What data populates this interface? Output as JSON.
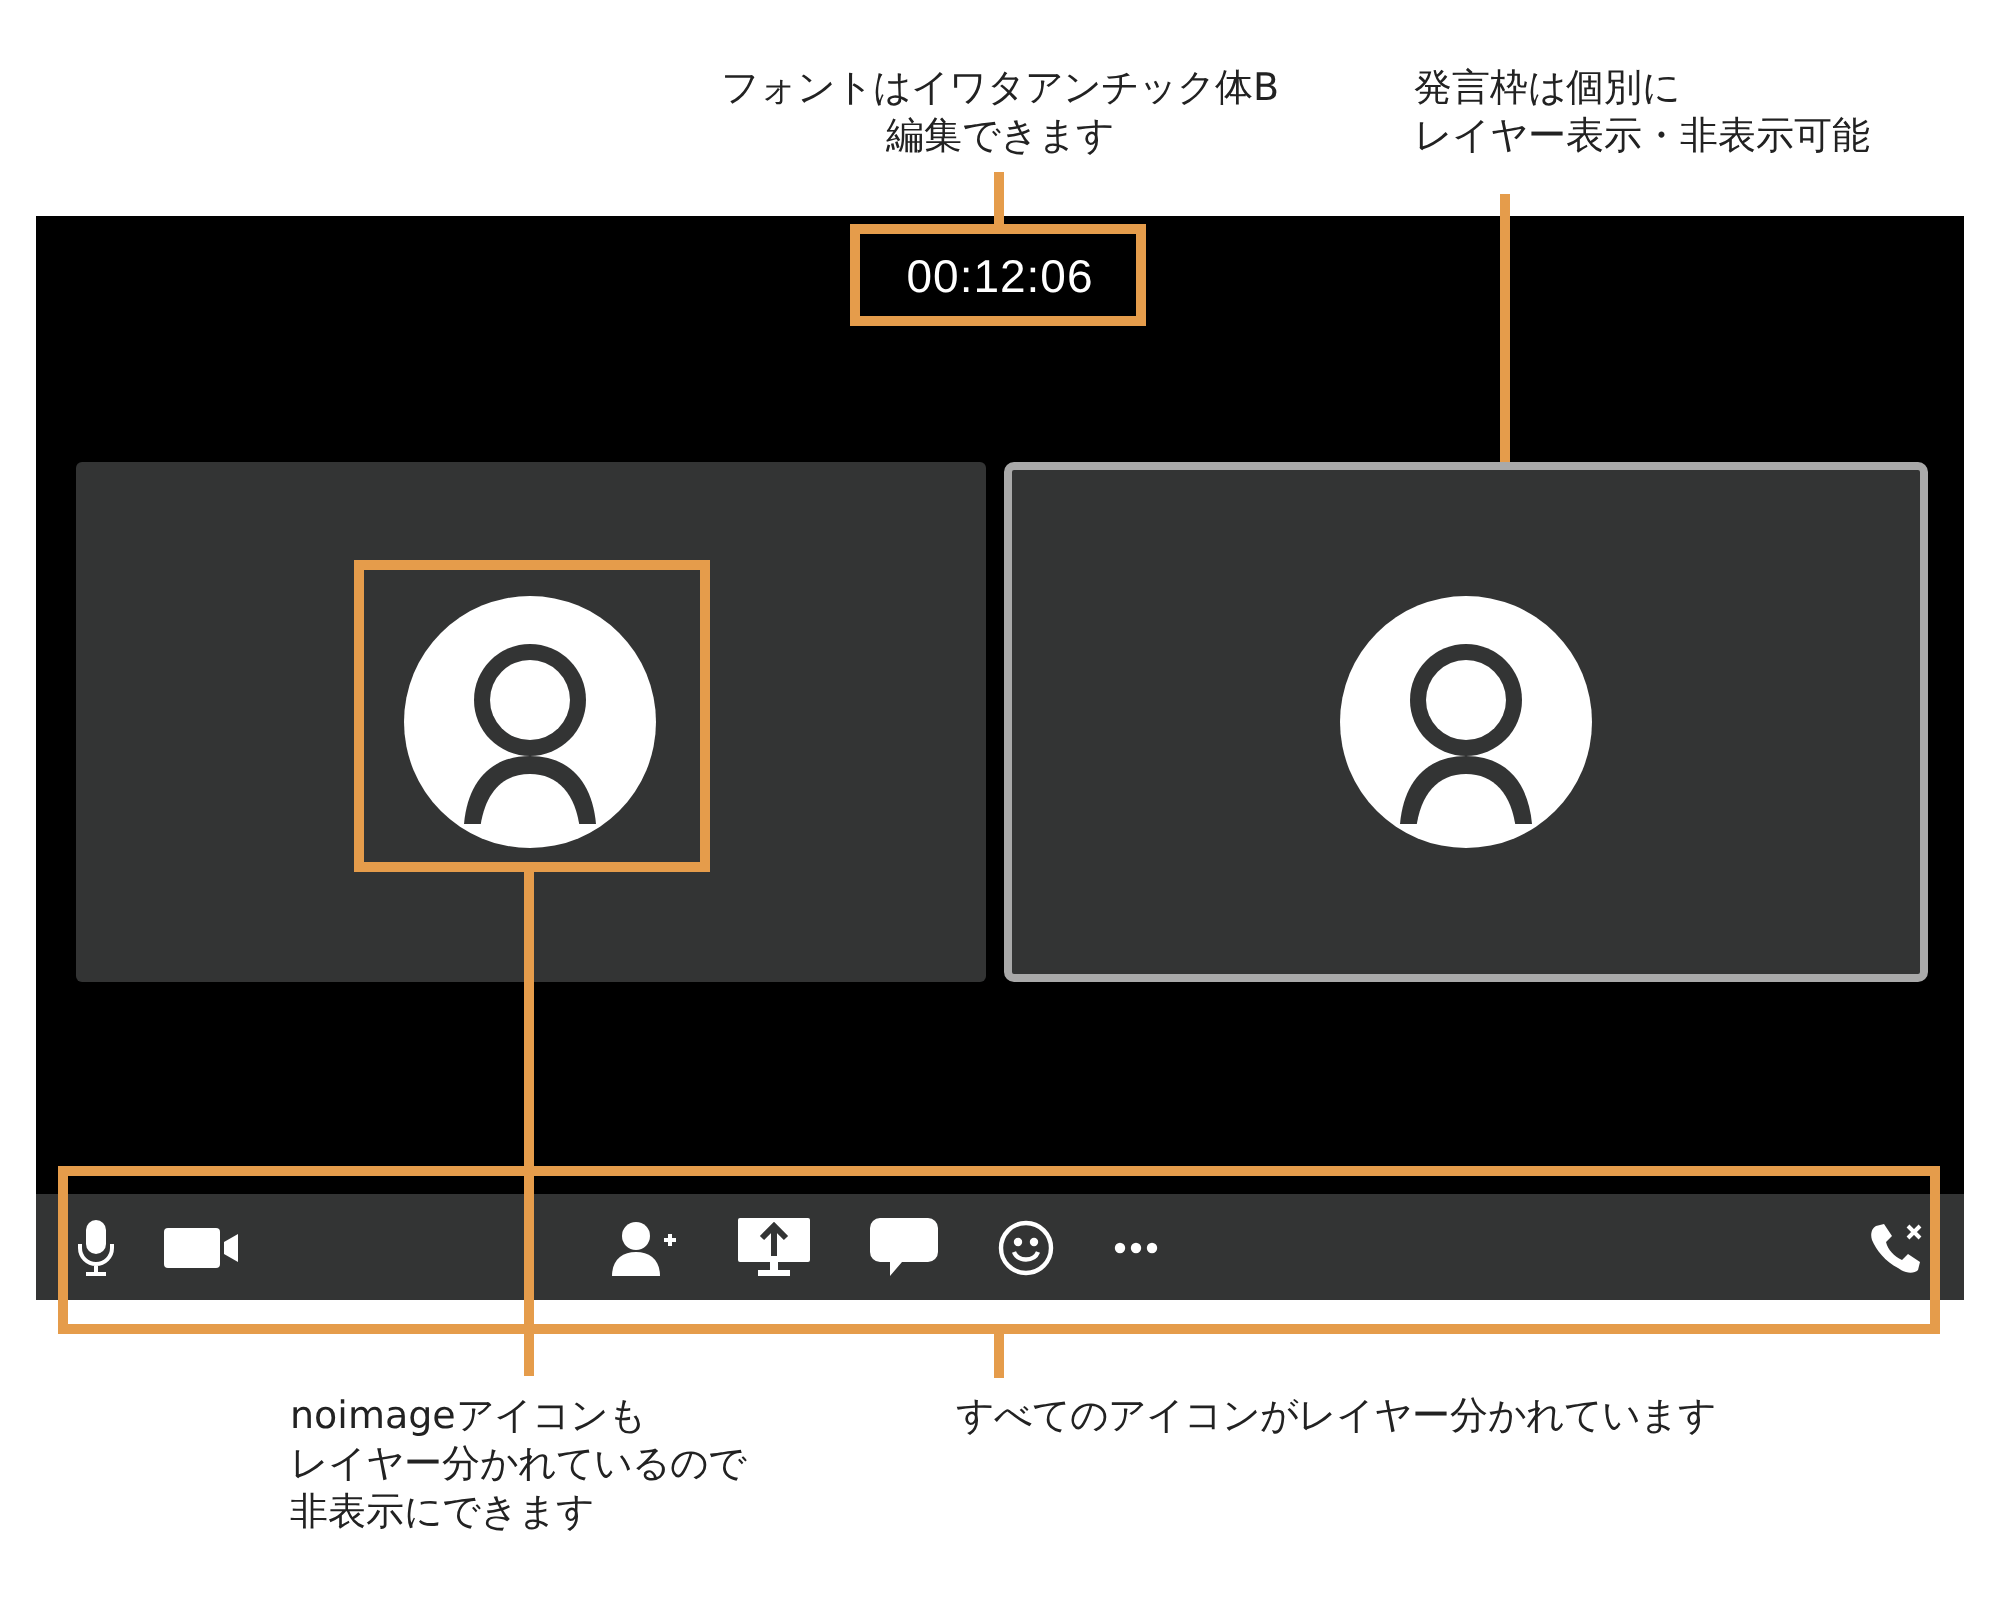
{
  "call": {
    "timer": "00:12:06",
    "tiles": [
      {
        "speaking": false
      },
      {
        "speaking": true
      }
    ]
  },
  "annotations": [
    {
      "lines": [
        "フォントはイワタアンチック体B",
        "編集できます"
      ]
    },
    {
      "lines": [
        "発言枠は個別に",
        "レイヤー表示・非表示可能"
      ]
    },
    {
      "lines": [
        "noimageアイコンも",
        "レイヤー分かれているので",
        "非表示にできます"
      ]
    },
    {
      "lines": [
        "すべてのアイコンがレイヤー分かれています"
      ]
    }
  ]
}
